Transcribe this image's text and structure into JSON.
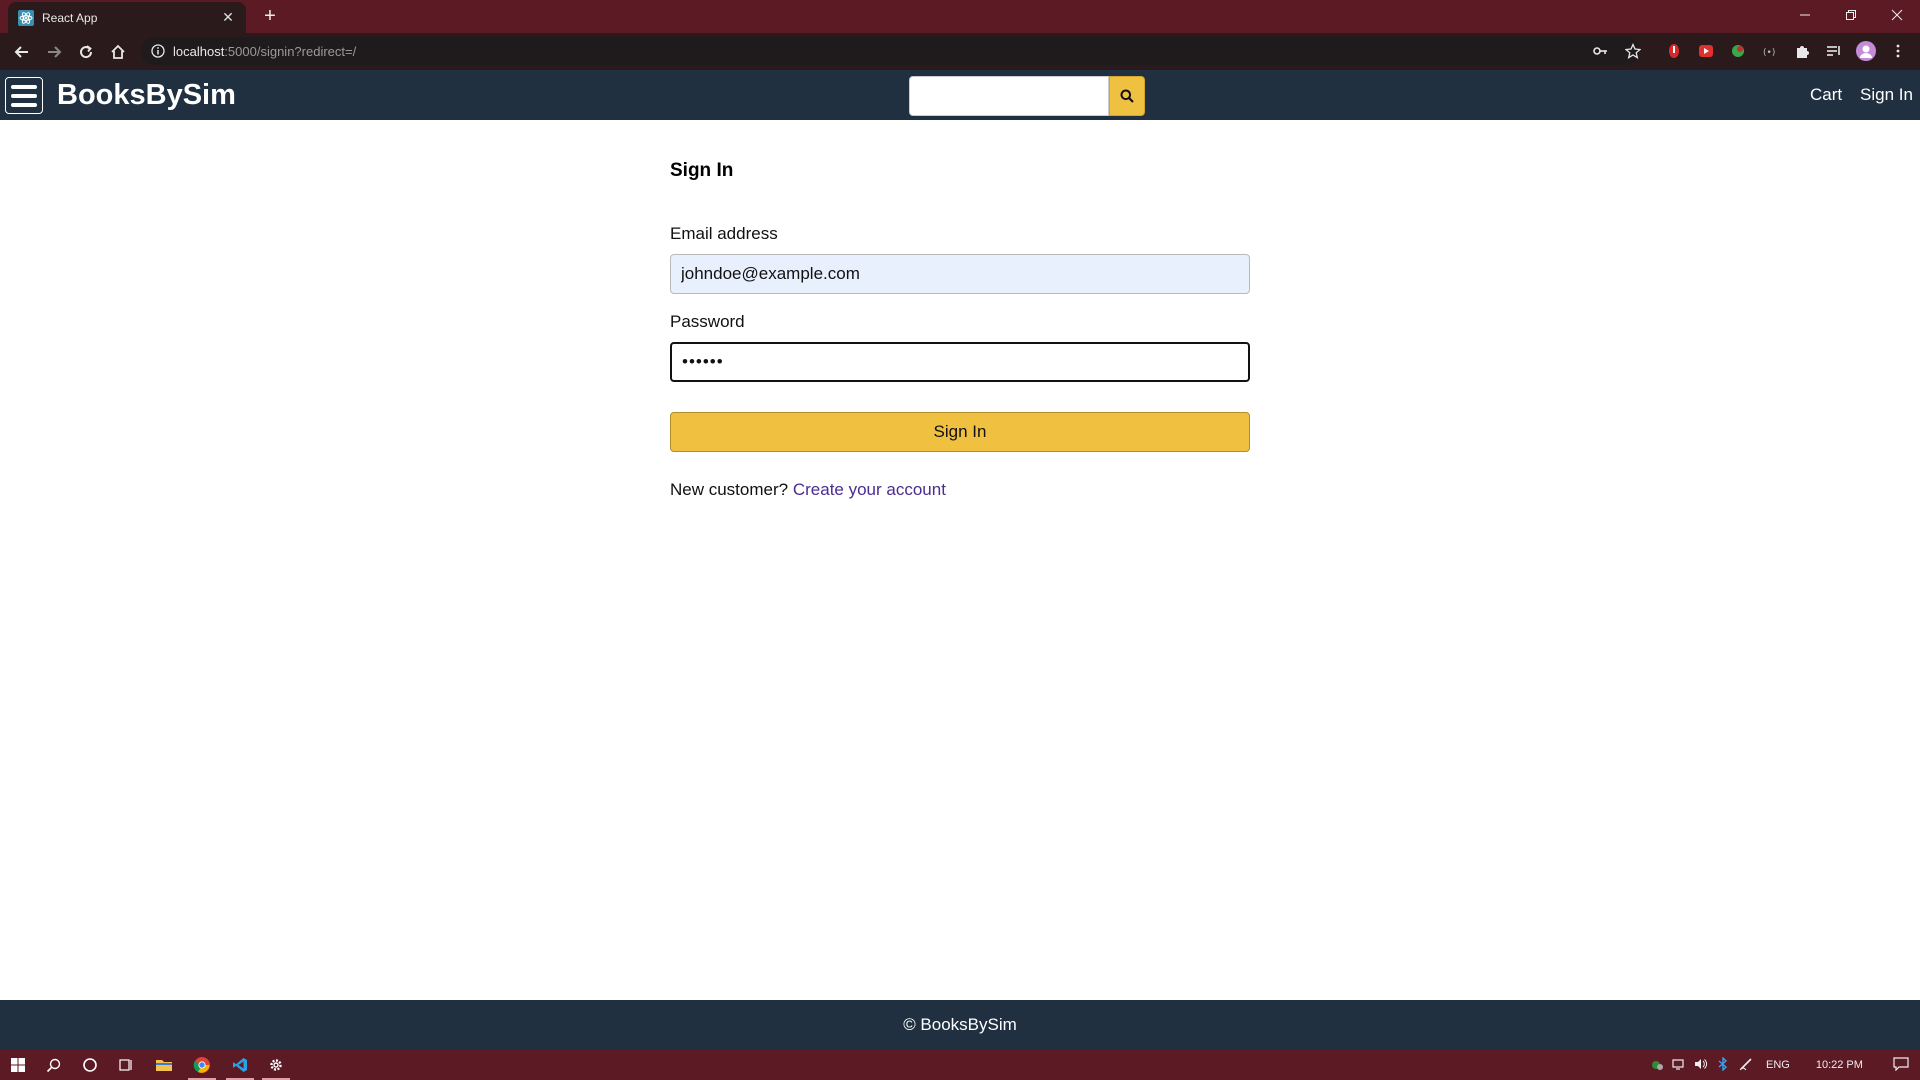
{
  "browser": {
    "tab_title": "React App",
    "url_host": "localhost",
    "url_path": ":5000/signin?redirect=/"
  },
  "header": {
    "brand": "BooksBySim",
    "search_placeholder": "",
    "cart_label": "Cart",
    "signin_label": "Sign In"
  },
  "form": {
    "title": "Sign In",
    "email_label": "Email address",
    "email_value": "johndoe@example.com",
    "password_label": "Password",
    "password_value": "••••••",
    "submit_label": "Sign In",
    "new_customer_text": "New customer?",
    "create_account_link": "Create your account"
  },
  "footer": {
    "text": "© BooksBySim"
  },
  "taskbar": {
    "language": "ENG",
    "time": "10:22 PM"
  },
  "colors": {
    "header_bg": "#203040",
    "accent": "#f0c040",
    "chrome_frame": "#5c1a24",
    "link": "#4b2c8f"
  }
}
